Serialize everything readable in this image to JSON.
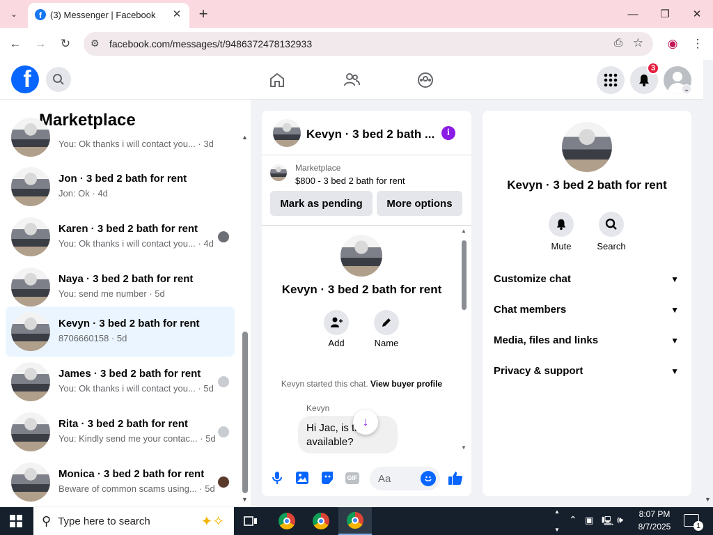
{
  "browser": {
    "tab_title": "(3) Messenger | Facebook",
    "url": "facebook.com/messages/t/9486372478132933"
  },
  "fb_header": {
    "notification_count": "3"
  },
  "left_panel": {
    "title": "Marketplace",
    "conversations": [
      {
        "name": "",
        "preview": "You: Ok thanks i will contact you... · 3d"
      },
      {
        "name": "Jon · 3 bed 2 bath for rent",
        "preview": "Jon: Ok · 4d"
      },
      {
        "name": "Karen · 3 bed 2 bath for rent",
        "preview": "You: Ok thanks i will contact you... · 4d"
      },
      {
        "name": "Naya · 3 bed 2 bath for rent",
        "preview": "You: send me number · 5d"
      },
      {
        "name": "Kevyn · 3 bed 2 bath for rent",
        "preview": "8706660158 · 5d"
      },
      {
        "name": "James · 3 bed 2 bath for rent",
        "preview": "You: Ok thanks i will contact you... · 5d"
      },
      {
        "name": "Rita · 3 bed 2 bath for rent",
        "preview": "You: Kindly send me your contac... · 5d"
      },
      {
        "name": "Monica · 3 bed 2 bath for rent",
        "preview": "Beware of common scams using... · 5d"
      }
    ]
  },
  "chat": {
    "header_name": "Kevyn · 3 bed 2 bath ...",
    "marketplace_label": "Marketplace",
    "listing": "$800 - 3 bed 2 bath for rent",
    "mark_pending": "Mark as pending",
    "more_options": "More options",
    "profile_name": "Kevyn · 3 bed 2 bath for rent",
    "add_label": "Add",
    "name_label": "Name",
    "started_text": "Kevyn started this chat.",
    "view_buyer": "View buyer profile",
    "sender": "Kevyn",
    "message": "Hi Jac, is th      l available?",
    "composer_placeholder": "Aa"
  },
  "right_panel": {
    "name": "Kevyn · 3 bed 2 bath for rent",
    "mute_label": "Mute",
    "search_label": "Search",
    "sections": [
      "Customize chat",
      "Chat members",
      "Media, files and links",
      "Privacy & support"
    ]
  },
  "taskbar": {
    "search_placeholder": "Type here to search",
    "time": "8:07 PM",
    "date": "8/7/2025",
    "notif_count": "1"
  }
}
